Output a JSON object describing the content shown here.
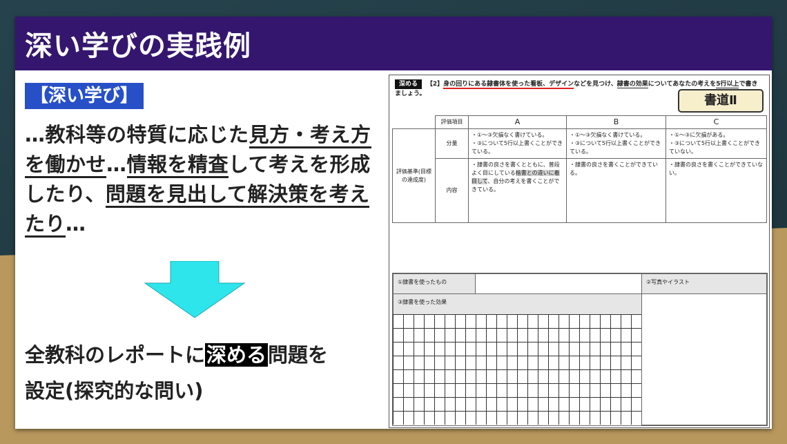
{
  "title": "深い学びの実践例",
  "tag": "【深い学び】",
  "body": {
    "p1": "…教科等の特質に応じた",
    "u1": "見方・考え方を働かせ",
    "p2": "…",
    "u2": "情報を精査",
    "p3": "して考えを形成したり、",
    "u3": "問題を見出して解決策を考えたり",
    "p4": "…"
  },
  "bottom": {
    "pre": "全教科のレポートに",
    "highlight": "深める",
    "post": "問題を",
    "line2": "設定(探究的な問い)"
  },
  "sheet": {
    "deep_label": "深める",
    "question_num": "【2】",
    "q_red": "身の回りにある隷書体を使った看板、デザイン",
    "q_mid": "などを見つけ、",
    "q_blk": "隷書の効果",
    "q_end": "についてあなたの考えを",
    "q_five": "5行以上",
    "q_tail": "で書きましょう。",
    "subject": "書道Ⅱ",
    "rubric": {
      "eval_items": "評価項目",
      "col_a": "A",
      "col_b": "B",
      "col_c": "C",
      "criteria": "評価基準(目標の達成度)",
      "row_amount": "分量",
      "row_content": "内容",
      "amount_a1": "・①～③欠損なく書けている。",
      "amount_a2": "・③について5行以上書くことができている。",
      "amount_b1": "・①～③欠損なく書けている。",
      "amount_b2": "・③について5行以上書くことができている。",
      "amount_c1": "・①～③に欠損がある。",
      "amount_c2": "・③について5行以上書くことができていない。",
      "content_a1": "・隷書の良さを書くとともに、普段よく目にしている",
      "content_a2": "楷書との違いに着目して",
      "content_a3": "、自分の考えを書くことができている。",
      "content_b": "・隷書の良さを書くことができている。",
      "content_c": "・隷書の良さを書くことができていない。"
    },
    "lower": {
      "used_item": "①隷書を使ったもの",
      "photo": "②写真やイラスト",
      "effect": "③隷書を使った効果"
    }
  },
  "colors": {
    "title_bar": "#34166e",
    "tag_bg": "#2750c8",
    "arrow": "#2ee5ec"
  }
}
